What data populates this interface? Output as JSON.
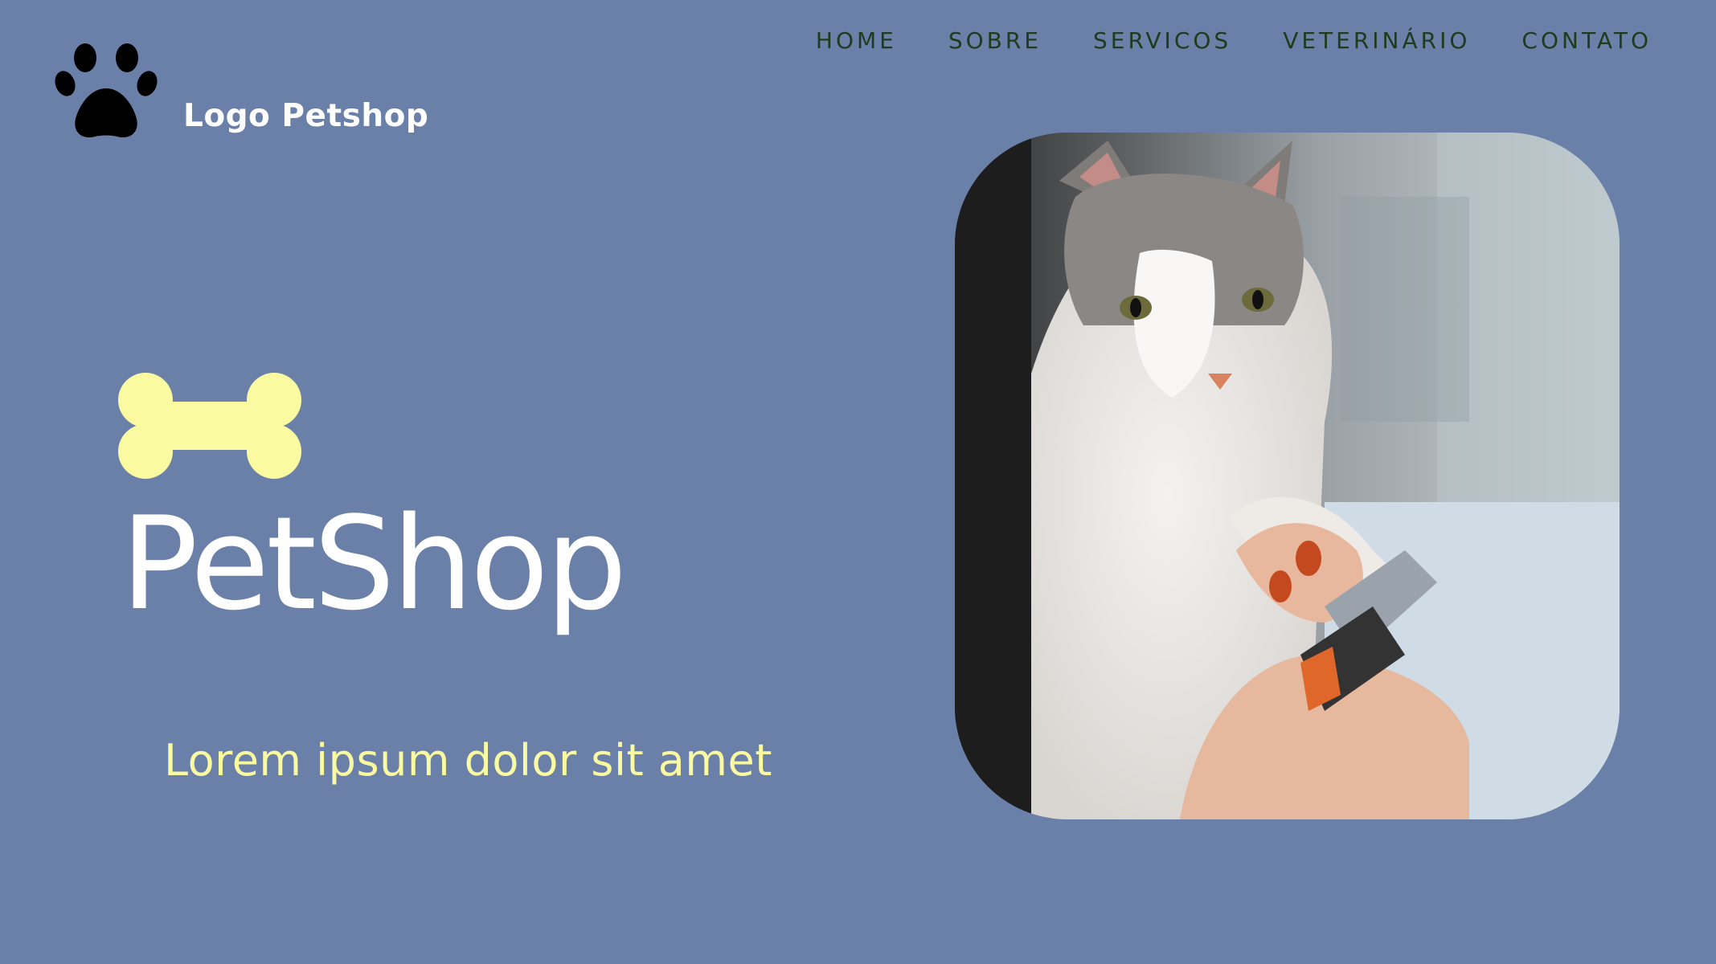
{
  "nav": {
    "items": [
      "HOME",
      "SOBRE",
      "SERVICOS",
      "VETERINÁRIO",
      "CONTATO"
    ]
  },
  "logo": {
    "text": "Logo Petshop",
    "icon": "paw-icon"
  },
  "hero": {
    "icon": "bone-icon",
    "title": "PetShop",
    "subtitle": "Lorem ipsum dolor sit amet"
  },
  "image": {
    "subject": "cat-nail-trimming-photo"
  },
  "colors": {
    "background": "#6a80a8",
    "nav_text": "#1f3a1c",
    "title": "#ffffff",
    "subtitle": "#fafba0",
    "bone": "#fafba0"
  }
}
